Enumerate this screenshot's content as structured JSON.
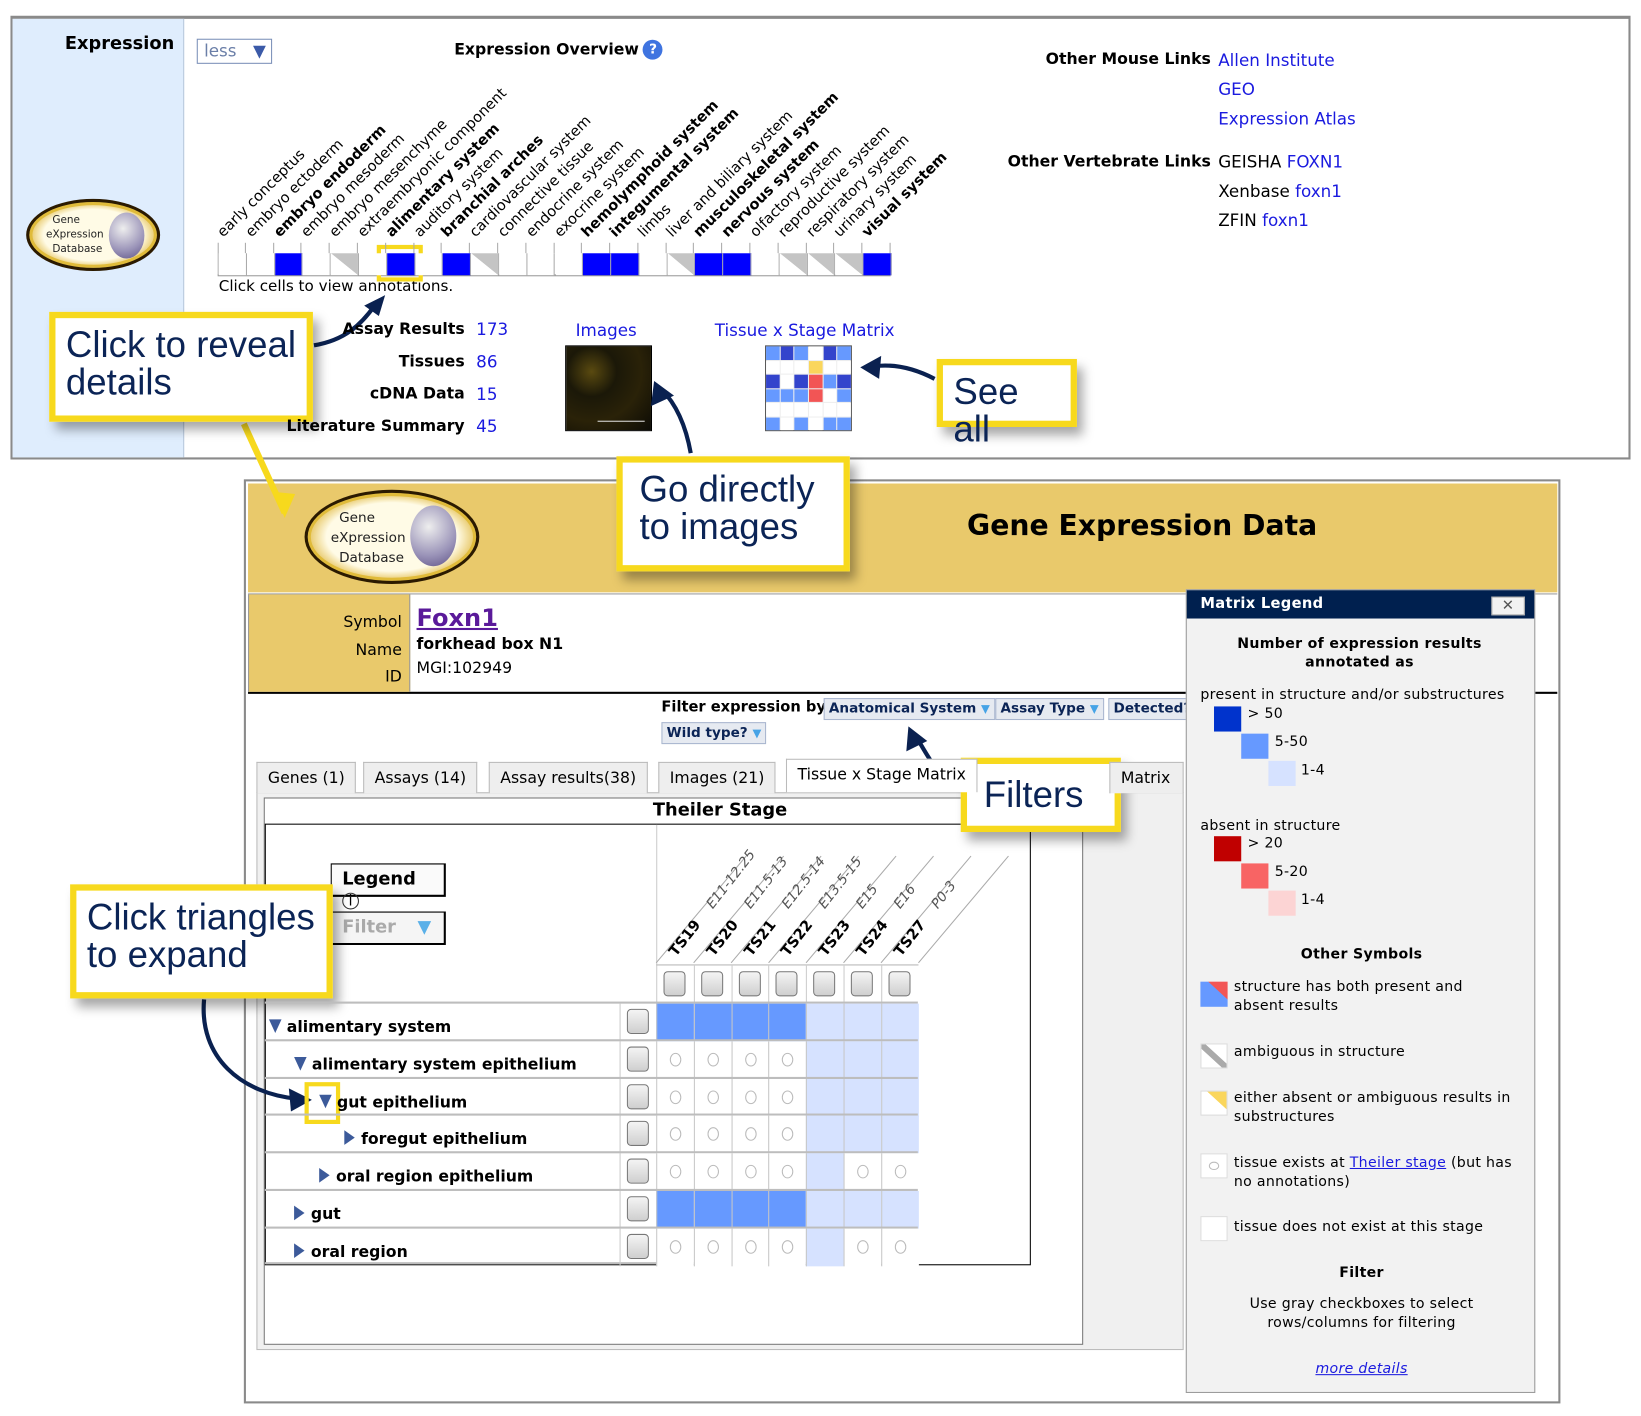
{
  "top": {
    "section_label": "Expression",
    "less_label": "less",
    "overview_title": "Expression Overview",
    "help_icon": "question-circle-icon",
    "logo_text": [
      "Gene",
      "eXpression",
      "Database"
    ],
    "click_hint": "Click cells to view annotations.",
    "overview_columns": [
      {
        "label": "early conceptus",
        "bold": false,
        "state": "white"
      },
      {
        "label": "embryo ectoderm",
        "bold": false,
        "state": "white"
      },
      {
        "label": "embryo endoderm",
        "bold": true,
        "state": "blue"
      },
      {
        "label": "embryo mesoderm",
        "bold": false,
        "state": "white"
      },
      {
        "label": "embryo mesenchyme",
        "bold": false,
        "state": "ambiguous"
      },
      {
        "label": "extraembryonic component",
        "bold": false,
        "state": "white"
      },
      {
        "label": "alimentary system",
        "bold": true,
        "state": "blue",
        "highlighted": true
      },
      {
        "label": "auditory system",
        "bold": false,
        "state": "white"
      },
      {
        "label": "branchial arches",
        "bold": true,
        "state": "blue"
      },
      {
        "label": "cardiovascular system",
        "bold": false,
        "state": "ambiguous"
      },
      {
        "label": "connective tissue",
        "bold": false,
        "state": "white"
      },
      {
        "label": "endocrine system",
        "bold": false,
        "state": "white"
      },
      {
        "label": "exocrine system",
        "bold": false,
        "state": "white"
      },
      {
        "label": "hemolymphoid system",
        "bold": true,
        "state": "blue"
      },
      {
        "label": "integumental system",
        "bold": true,
        "state": "blue"
      },
      {
        "label": "limbs",
        "bold": false,
        "state": "white"
      },
      {
        "label": "liver and biliary system",
        "bold": false,
        "state": "ambiguous"
      },
      {
        "label": "musculoskeletal system",
        "bold": true,
        "state": "blue"
      },
      {
        "label": "nervous system",
        "bold": true,
        "state": "blue"
      },
      {
        "label": "olfactory system",
        "bold": false,
        "state": "white"
      },
      {
        "label": "reproductive system",
        "bold": false,
        "state": "ambiguous"
      },
      {
        "label": "respiratory system",
        "bold": false,
        "state": "ambiguous"
      },
      {
        "label": "urinary system",
        "bold": false,
        "state": "ambiguous"
      },
      {
        "label": "visual system",
        "bold": true,
        "state": "blue"
      }
    ],
    "stats": [
      {
        "label": "Assay Results",
        "value": "173"
      },
      {
        "label": "Tissues",
        "value": "86"
      },
      {
        "label": "cDNA Data",
        "value": "15"
      },
      {
        "label": "Literature Summary",
        "value": "45"
      }
    ],
    "images_label": "Images",
    "matrix_label": "Tissue x Stage Matrix",
    "other_mouse_label": "Other Mouse Links",
    "other_mouse_links": [
      "Allen Institute",
      "GEO",
      "Expression Atlas"
    ],
    "other_vert_label": "Other Vertebrate Links",
    "other_vert_links": [
      {
        "prefix": "GEISHA",
        "link": "FOXN1"
      },
      {
        "prefix": "Xenbase",
        "link": "foxn1"
      },
      {
        "prefix": "ZFIN",
        "link": "foxn1"
      }
    ]
  },
  "callouts": {
    "reveal": "Click to reveal details",
    "see_all": "See all",
    "images": "Go directly to images",
    "filters": "Filters",
    "triangles": "Click triangles to expand"
  },
  "gene": {
    "header_title": "Gene Expression Data",
    "symbol_label": "Symbol",
    "name_label": "Name",
    "id_label": "ID",
    "symbol": "Foxn1",
    "name": "forkhead box N1",
    "id": "MGI:102949"
  },
  "filters": {
    "label": "Filter expression by:",
    "buttons": [
      "Anatomical System",
      "Assay Type",
      "Detected?",
      "Wild type?"
    ]
  },
  "tabs": [
    "Genes (1)",
    "Assays (14)",
    "Assay results(38)",
    "Images (21)",
    "Tissue x Stage Matrix",
    "Matrix"
  ],
  "active_tab": "Tissue x Stage Matrix",
  "matrix": {
    "title": "Theiler Stage",
    "legend_button": "Legend",
    "filter_button": "Filter",
    "stages": [
      "TS19",
      "TS20",
      "TS21",
      "TS22",
      "TS23",
      "TS24",
      "TS27"
    ],
    "ages": [
      "E11-12.25",
      "E11.5-13",
      "E12.5-14",
      "E13.5-15",
      "E15",
      "E16",
      "P0-3"
    ],
    "rows": [
      {
        "label": "alimentary system",
        "indent": 0,
        "expander": "down",
        "cells": [
          "m",
          "m",
          "m",
          "m",
          "l",
          "l",
          "l"
        ]
      },
      {
        "label": "alimentary system epithelium",
        "indent": 1,
        "expander": "down",
        "cells": [
          "o",
          "o",
          "o",
          "o",
          "l",
          "l",
          "l"
        ]
      },
      {
        "label": "gut epithelium",
        "indent": 2,
        "expander": "down",
        "cells": [
          "o",
          "o",
          "o",
          "o",
          "l",
          "l",
          "l"
        ]
      },
      {
        "label": "foregut epithelium",
        "indent": 3,
        "expander": "right",
        "cells": [
          "o",
          "o",
          "o",
          "o",
          "l",
          "l",
          "l"
        ]
      },
      {
        "label": "oral region epithelium",
        "indent": 2,
        "expander": "right",
        "cells": [
          "o",
          "o",
          "o",
          "o",
          "l",
          "o",
          "o"
        ]
      },
      {
        "label": "gut",
        "indent": 1,
        "expander": "right",
        "cells": [
          "m",
          "m",
          "m",
          "m",
          "l",
          "l",
          "l"
        ]
      },
      {
        "label": "oral region",
        "indent": 1,
        "expander": "right",
        "cells": [
          "o",
          "o",
          "o",
          "o",
          "l",
          "o",
          "o"
        ]
      }
    ]
  },
  "legend": {
    "title": "Matrix Legend",
    "heading": "Number of expression results annotated as",
    "present_label": "present in structure and/or substructures",
    "present_levels": [
      ">  50",
      "5-50",
      "1-4"
    ],
    "absent_label": "absent in structure",
    "absent_levels": [
      ">  20",
      "5-20",
      "1-4"
    ],
    "other_heading": "Other Symbols",
    "both": "structure has both present and absent results",
    "ambiguous": "ambiguous in structure",
    "either": "either absent or ambiguous results in substructures",
    "exists_pre": "tissue exists at ",
    "exists_link": "Theiler stage",
    "exists_post": " (but has no annotations)",
    "not_exist": "tissue does not exist at this stage",
    "filter_heading": "Filter",
    "filter_text": "Use gray checkboxes to select rows/columns for filtering",
    "more": "more details"
  },
  "colors": {
    "strong_blue": "#0000ff",
    "present_high": "#0033cc",
    "present_mid": "#6699ff",
    "present_low": "#d6e2ff",
    "absent_high": "#c00000",
    "absent_mid": "#f86464",
    "absent_low": "#fcd4d4",
    "callout_border": "#f7d91d",
    "gene_header": "#e9c96b"
  }
}
